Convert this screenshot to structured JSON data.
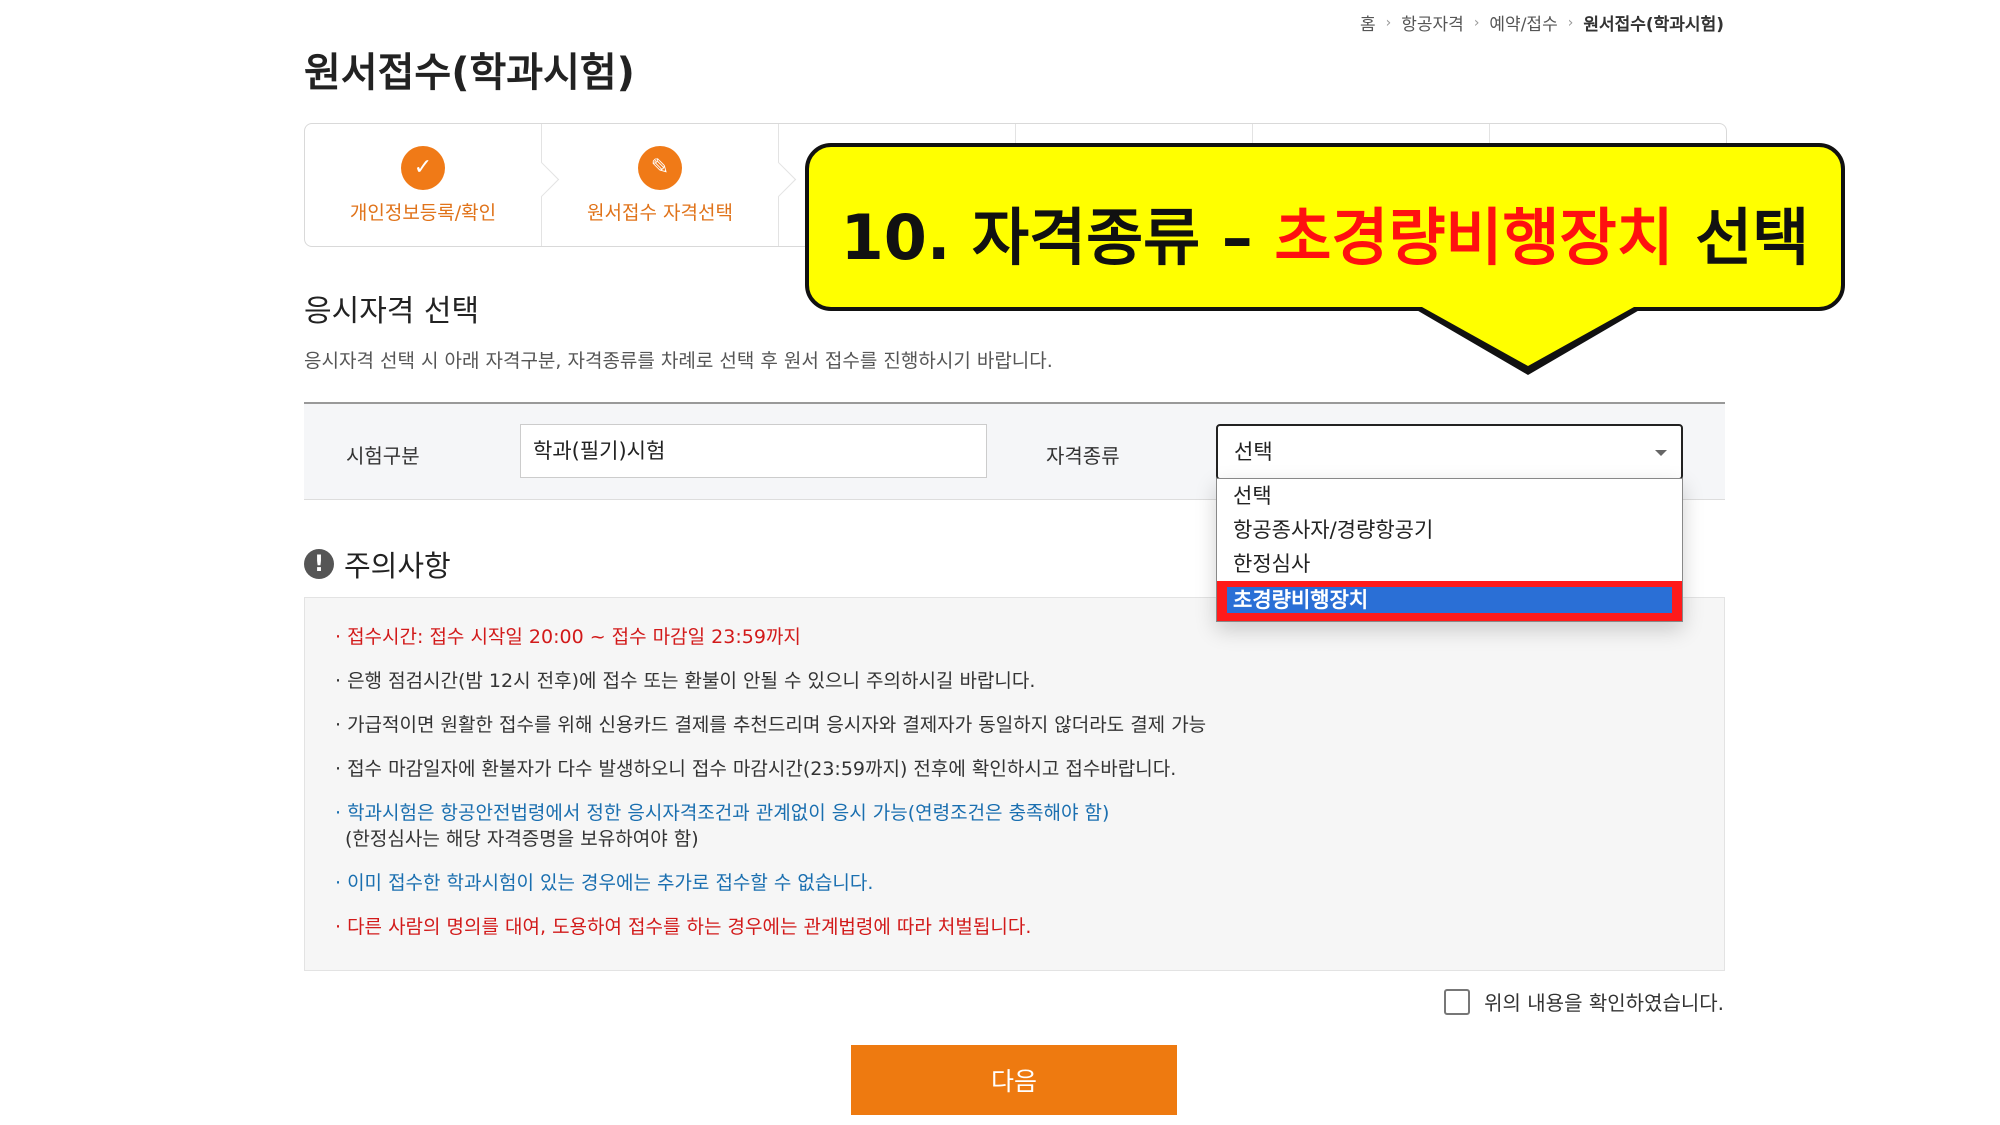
{
  "breadcrumb": {
    "home": "홈",
    "item1": "항공자격",
    "item2": "예약/접수",
    "current": "원서접수(학과시험)"
  },
  "page_title": "원서접수(학과시험)",
  "steps": [
    {
      "label": "개인정보등록/확인",
      "icon": "check-icon"
    },
    {
      "label": "원서접수 자격선택",
      "icon": "pencil-icon"
    }
  ],
  "callout": {
    "prefix": "10. 자격종류 – ",
    "highlight": "초경량비행장치",
    "suffix": " 선택",
    "highlight_color": "#ff1010",
    "bg_color": "#ffff00"
  },
  "section": {
    "title": "응시자격 선택",
    "desc": "응시자격 선택 시 아래 자격구분, 자격종류를 차례로 선택 후 원서 접수를 진행하시기 바랍니다."
  },
  "form": {
    "exam_type_label": "시험구분",
    "exam_type_value": "학과(필기)시험",
    "qual_type_label": "자격종류",
    "qual_type_value": "선택",
    "options": [
      "선택",
      "항공종사자/경량항공기",
      "한정심사",
      "초경량비행장치"
    ]
  },
  "notice": {
    "title": "주의사항",
    "items": [
      {
        "text": "· 접수시간: 접수 시작일 20:00 ~ 접수 마감일 23:59까지",
        "style": "red"
      },
      {
        "text": "· 은행 점검시간(밤 12시 전후)에 접수 또는 환불이 안될 수 있으니 주의하시길 바랍니다.",
        "style": "plain"
      },
      {
        "text": "· 가급적이면 원활한 접수를 위해 신용카드 결제를 추천드리며 응시자와 결제자가 동일하지 않더라도 결제 가능",
        "style": "plain"
      },
      {
        "text": "· 접수 마감일자에 환불자가 다수 발생하오니 접수 마감시간(23:59까지) 전후에 확인하시고 접수바랍니다.",
        "style": "plain"
      },
      {
        "text": "· 학과시험은 항공안전법령에서 정한 응시자격조건과 관계없이 응시 가능(연령조건은 충족해야 함)",
        "sub": "(한정심사는 해당 자격증명을 보유하여야 함)",
        "style": "blue"
      },
      {
        "text": "· 이미 접수한 학과시험이 있는 경우에는 추가로 접수할 수 없습니다.",
        "style": "blue"
      },
      {
        "text": "· 다른 사람의 명의를 대여, 도용하여 접수를 하는 경우에는 관계법령에 따라 처벌됩니다.",
        "style": "red"
      }
    ]
  },
  "confirm_label": "위의 내용을 확인하였습니다.",
  "next_button": "다음",
  "colors": {
    "accent": "#ee7a10",
    "highlight_option": "#2a6fd6",
    "notice_red": "#d21a1a",
    "notice_blue": "#1a6fb0"
  }
}
